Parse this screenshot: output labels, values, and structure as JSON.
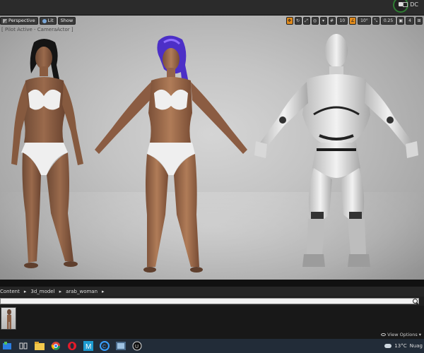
{
  "topbar": {
    "right_label": "DC"
  },
  "viewport": {
    "perspective_label": "Perspective",
    "lit_label": "Lit",
    "show_label": "Show",
    "pilot_label": "[ Pilot Active - CameraActor ]",
    "snap_grid": "10",
    "snap_rotation": "10°",
    "snap_scale": "0.25",
    "camera_speed": "4"
  },
  "content_browser": {
    "breadcrumbs": [
      "Content",
      "3d_model",
      "arab_woman"
    ],
    "view_options_label": "View Options"
  },
  "taskbar": {
    "apps": [
      "search-icon",
      "task-view-icon",
      "file-explorer-icon",
      "chrome-icon",
      "opera-icon",
      "unreal-market-icon",
      "cortana-icon",
      "media-icon",
      "unreal-engine-icon"
    ],
    "temperature": "13°C",
    "weather": "Nuag"
  },
  "colors": {
    "accent": "#e08a1c",
    "taskbar": "#222c38",
    "viewport_bg": "#c4c4c4"
  }
}
